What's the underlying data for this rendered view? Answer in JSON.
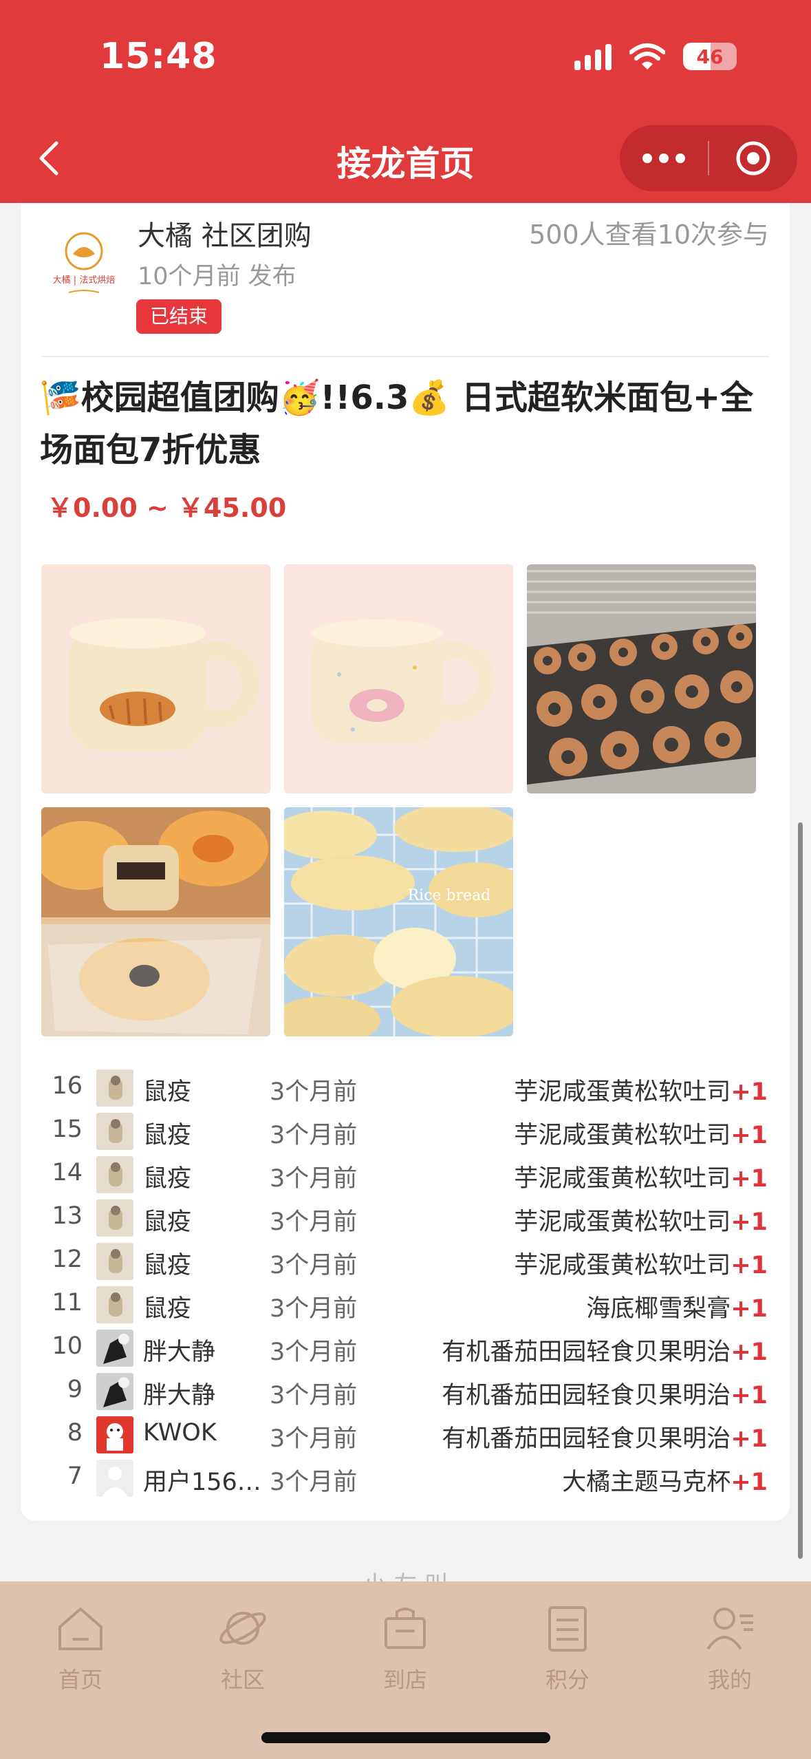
{
  "status_bar": {
    "time": "15:48",
    "battery": "46"
  },
  "nav": {
    "title": "接龙首页"
  },
  "post": {
    "author": "大橘 社区团购",
    "stats": "500人查看10次参与",
    "posted": "10个月前 发布",
    "status_badge": "已结束",
    "title": "🎏校园超值团购🥳!!6.3💰 日式超软米面包+全场面包7折优惠",
    "price": "￥0.00 ~ ￥45.00",
    "logo_text": "大橘 | 法式烘焙",
    "images": [
      "bread mug",
      "donut mug",
      "bagels on trays",
      "custard buns",
      "rice bread"
    ],
    "image_watermark": "Rice bread"
  },
  "participants": [
    {
      "n": "16",
      "name": "鼠疫",
      "time": "3个月前",
      "item": "芋泥咸蛋黄松软吐司",
      "plus": "+1",
      "avatar": "cat"
    },
    {
      "n": "15",
      "name": "鼠疫",
      "time": "3个月前",
      "item": "芋泥咸蛋黄松软吐司",
      "plus": "+1",
      "avatar": "cat"
    },
    {
      "n": "14",
      "name": "鼠疫",
      "time": "3个月前",
      "item": "芋泥咸蛋黄松软吐司",
      "plus": "+1",
      "avatar": "cat"
    },
    {
      "n": "13",
      "name": "鼠疫",
      "time": "3个月前",
      "item": "芋泥咸蛋黄松软吐司",
      "plus": "+1",
      "avatar": "cat"
    },
    {
      "n": "12",
      "name": "鼠疫",
      "time": "3个月前",
      "item": "芋泥咸蛋黄松软吐司",
      "plus": "+1",
      "avatar": "cat"
    },
    {
      "n": "11",
      "name": "鼠疫",
      "time": "3个月前",
      "item": "海底椰雪梨膏",
      "plus": "+1",
      "avatar": "cat"
    },
    {
      "n": "10",
      "name": "胖大静",
      "time": "3个月前",
      "item": "有机番茄田园轻食贝果明治",
      "plus": "+1",
      "avatar": "bw"
    },
    {
      "n": "9",
      "name": "胖大静",
      "time": "3个月前",
      "item": "有机番茄田园轻食贝果明治",
      "plus": "+1",
      "avatar": "bw"
    },
    {
      "n": "8",
      "name": "KWOK",
      "time": "3个月前",
      "item": "有机番茄田园轻食贝果明治",
      "plus": "+1",
      "avatar": "red"
    },
    {
      "n": "7",
      "name": "用户156…",
      "time": "3个月前",
      "item": "大橘主题马克杯",
      "plus": "+1",
      "avatar": "default"
    }
  ],
  "bottom_tip": "小 左 叫",
  "tabbar": [
    {
      "label": "首页",
      "icon": "home-icon"
    },
    {
      "label": "社区",
      "icon": "planet-icon"
    },
    {
      "label": "到店",
      "icon": "shopping-bag-icon"
    },
    {
      "label": "积分",
      "icon": "list-icon"
    },
    {
      "label": "我的",
      "icon": "user-icon"
    }
  ],
  "colors": {
    "brand_red": "#e03a3c",
    "price_red": "#d9403b",
    "tabbar_bg": "#dfc2ad"
  }
}
